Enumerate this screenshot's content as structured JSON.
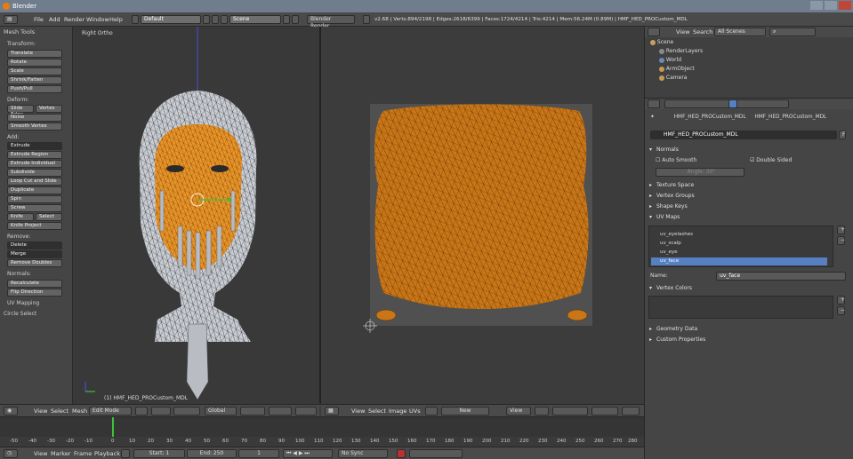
{
  "window": {
    "title": "Blender"
  },
  "info_header": {
    "menus": [
      "File",
      "Add",
      "Render",
      "Window",
      "Help"
    ],
    "layout": "Default",
    "scene": "Scene",
    "engine": "Blender Render",
    "stats": "v2.68 | Verts:894/2198 | Edges:2618/6399 | Faces:1724/4214 | Tris:4214 | Mem:56.24M (0.89M) | HMF_HED_PROCustom_MDL"
  },
  "tool_shelf": {
    "title": "Mesh Tools",
    "transform_label": "Transform:",
    "transform": [
      "Translate",
      "Rotate",
      "Scale",
      "Shrink/Fatten",
      "Push/Pull"
    ],
    "deform_label": "Deform:",
    "slide_edge": "Slide Edge",
    "vertex": "Vertex",
    "deform": [
      "Noise",
      "Smooth Vertex"
    ],
    "add_label": "Add:",
    "extrude": "Extrude",
    "add": [
      "Extrude Region",
      "Extrude Individual",
      "Subdivide",
      "Loop Cut and Slide",
      "Duplicate",
      "Spin",
      "Screw"
    ],
    "knife": "Knife",
    "select": "Select",
    "knife_project": "Knife Project",
    "remove_label": "Remove:",
    "delete": "Delete",
    "merge": "Merge",
    "remove_doubles": "Remove Doubles",
    "normals_label": "Normals:",
    "recalculate": "Recalculate",
    "flip_direction": "Flip Direction",
    "uv_mapping": "UV Mapping",
    "circle_select": "Circle Select"
  },
  "viewport": {
    "view_name": "Right Ortho",
    "object_label": "(1) HMF_HED_PROCustom_MDL"
  },
  "header_3d": {
    "menus": [
      "View",
      "Select",
      "Mesh"
    ],
    "mode": "Edit Mode",
    "orientation": "Global"
  },
  "header_uv": {
    "menus": [
      "View",
      "Select",
      "Image",
      "UVs"
    ],
    "new_label": "New",
    "view_label": "View"
  },
  "timeline": {
    "ticks": [
      "-50",
      "-40",
      "-30",
      "-20",
      "-10",
      "0",
      "10",
      "20",
      "30",
      "40",
      "50",
      "60",
      "70",
      "80",
      "90",
      "100",
      "110",
      "120",
      "130",
      "140",
      "150",
      "160",
      "170",
      "180",
      "190",
      "200",
      "210",
      "220",
      "230",
      "240",
      "250",
      "260",
      "270",
      "280",
      "289"
    ]
  },
  "header_timeline": {
    "menus": [
      "View",
      "Marker",
      "Frame",
      "Playback"
    ],
    "start": "Start: 1",
    "end": "End: 250",
    "current": "1",
    "sync": "No Sync"
  },
  "outliner": {
    "view": "View",
    "search": "Search",
    "filter": "All Scenes",
    "items": [
      "Scene",
      "RenderLayers",
      "World",
      "ArmObject",
      "Camera"
    ]
  },
  "properties": {
    "object_name": "HMF_HED_PROCustom_MDL",
    "breadcrumb_mesh": "HMF_HED_PROCustom_MDL",
    "mesh_name": "HMF_HED_PROCustom_MDL",
    "mesh_field_f": "F",
    "normals": "Normals",
    "auto_smooth": "Auto Smooth",
    "double_sided": "Double Sided",
    "angle": "Angle: 30°",
    "panels_collapsed": [
      "Texture Space",
      "Vertex Groups",
      "Shape Keys"
    ],
    "uv_maps_label": "UV Maps",
    "uv_maps": [
      "uv_eyelashes",
      "uv_scalp",
      "uv_eye",
      "uv_face"
    ],
    "name_label": "Name:",
    "name_value": "uv_face",
    "vertex_colors": "Vertex Colors",
    "panels_end": [
      "Geometry Data",
      "Custom Properties"
    ]
  },
  "colors": {
    "accent": "#e87d0d",
    "selection": "#5680c2",
    "mesh_orange": "#d07a1a"
  }
}
